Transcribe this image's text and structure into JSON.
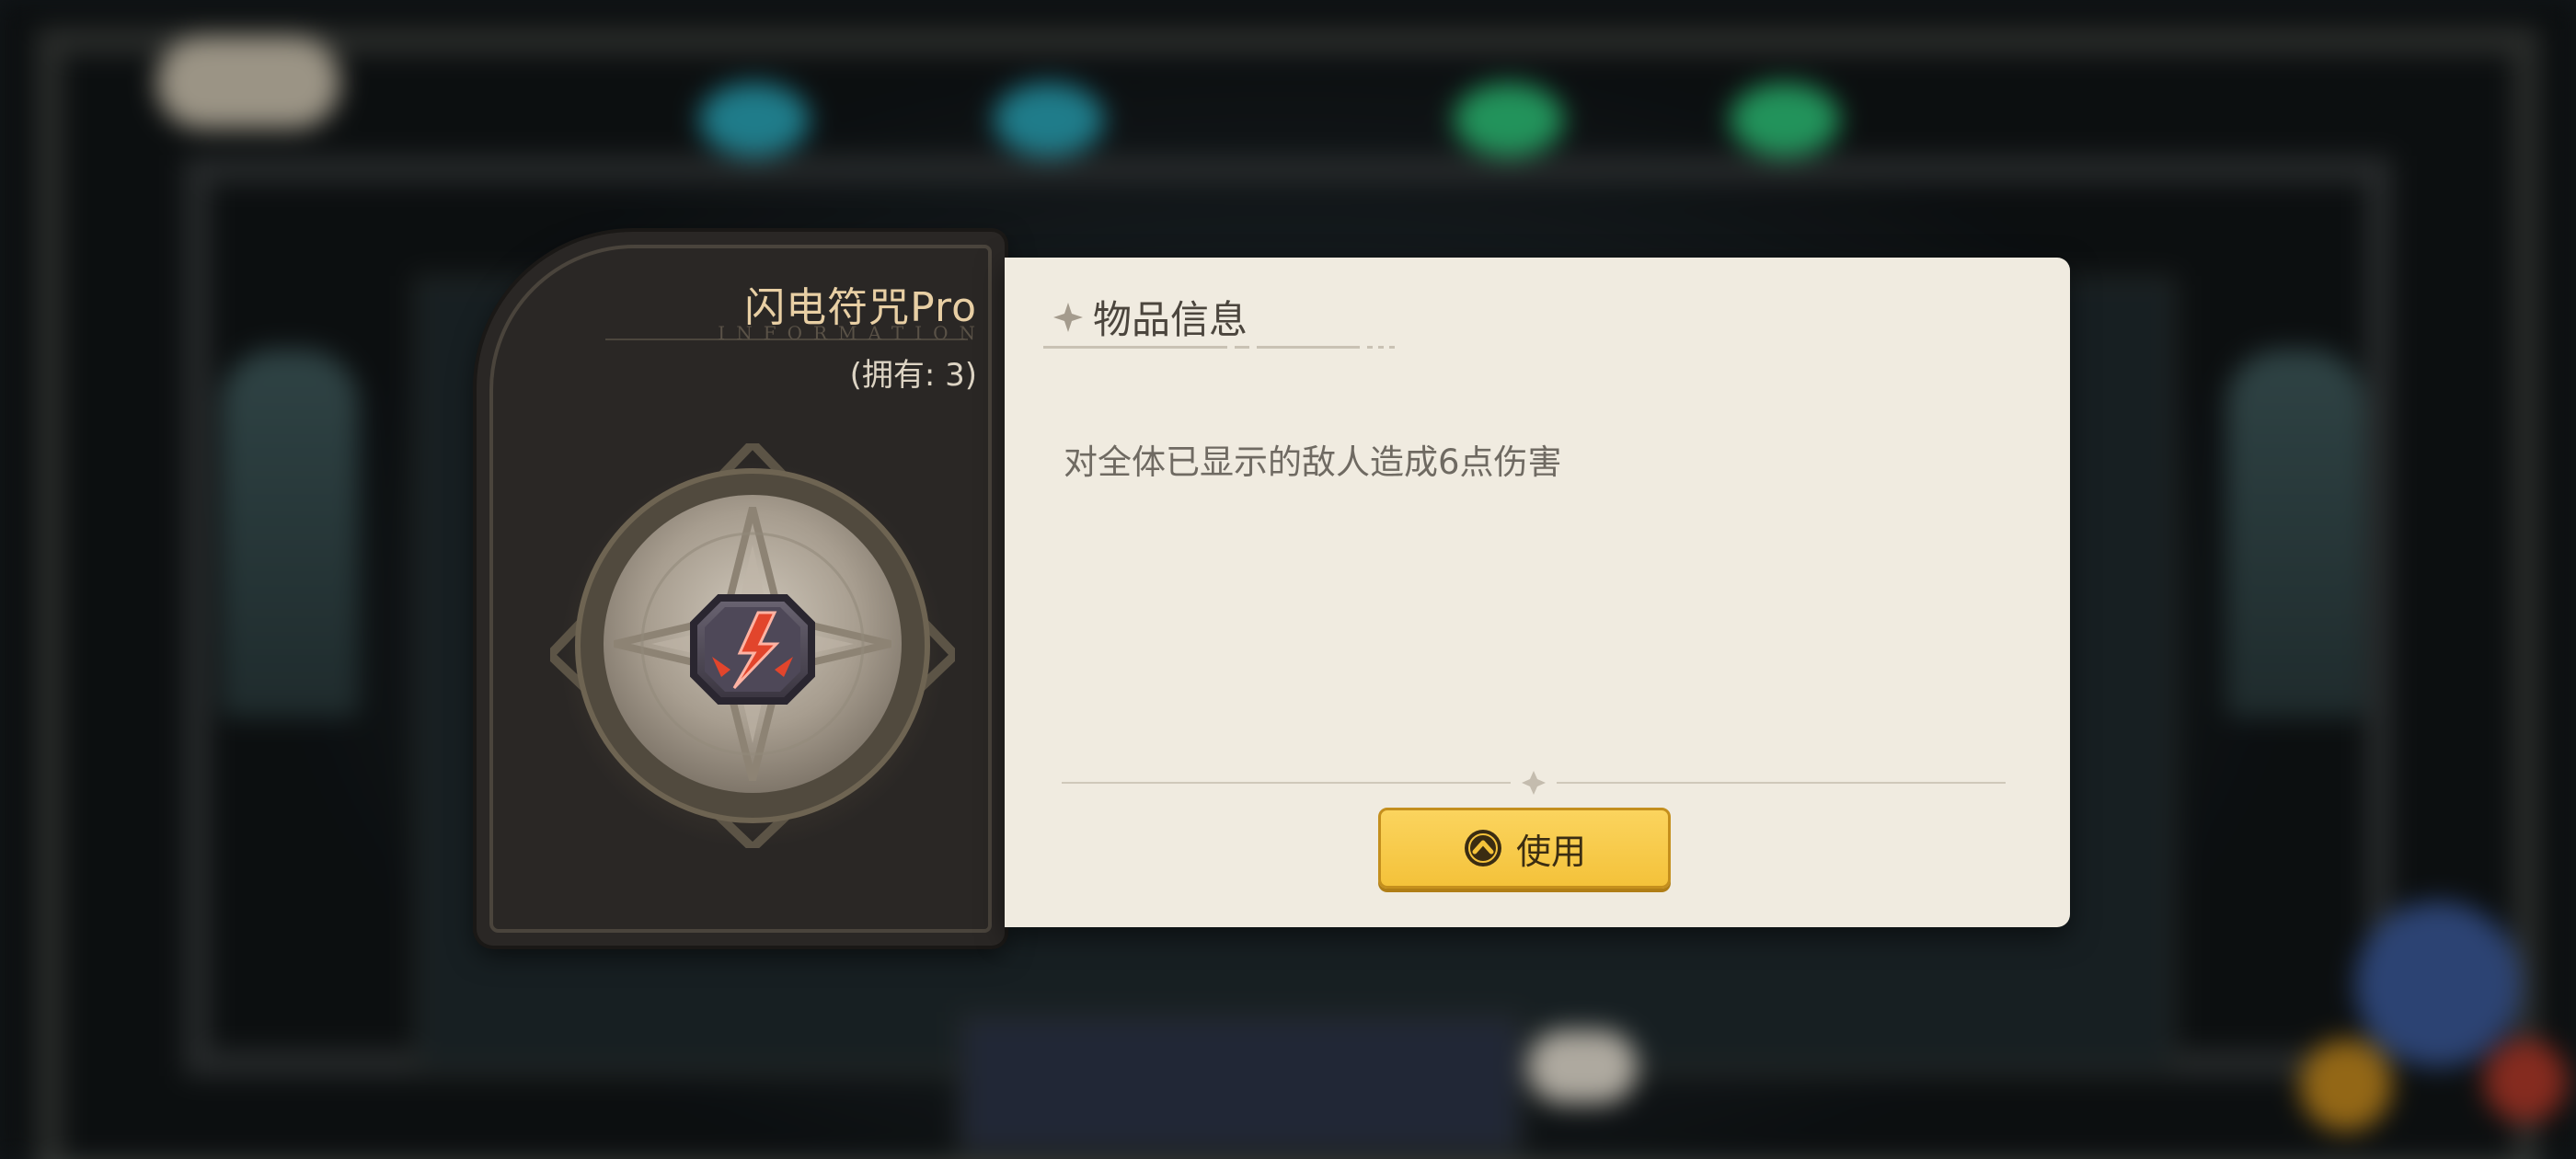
{
  "item": {
    "name": "闪电符咒Pro",
    "watermark": "INFORMATION",
    "owned_text": "(拥有: 3)",
    "icon": "lightning-rune-icon"
  },
  "info": {
    "title": "物品信息",
    "description": "对全体已显示的敌人造成6点伤害"
  },
  "actions": {
    "use_label": "使用",
    "use_icon": "chevron-up-circle-icon"
  },
  "colors": {
    "panel_bg": "#f0ebe0",
    "card_bg": "#2a2725",
    "name_color": "#e8cfa4",
    "button_fill": "#f4c23a",
    "rune_red": "#e2452c"
  }
}
